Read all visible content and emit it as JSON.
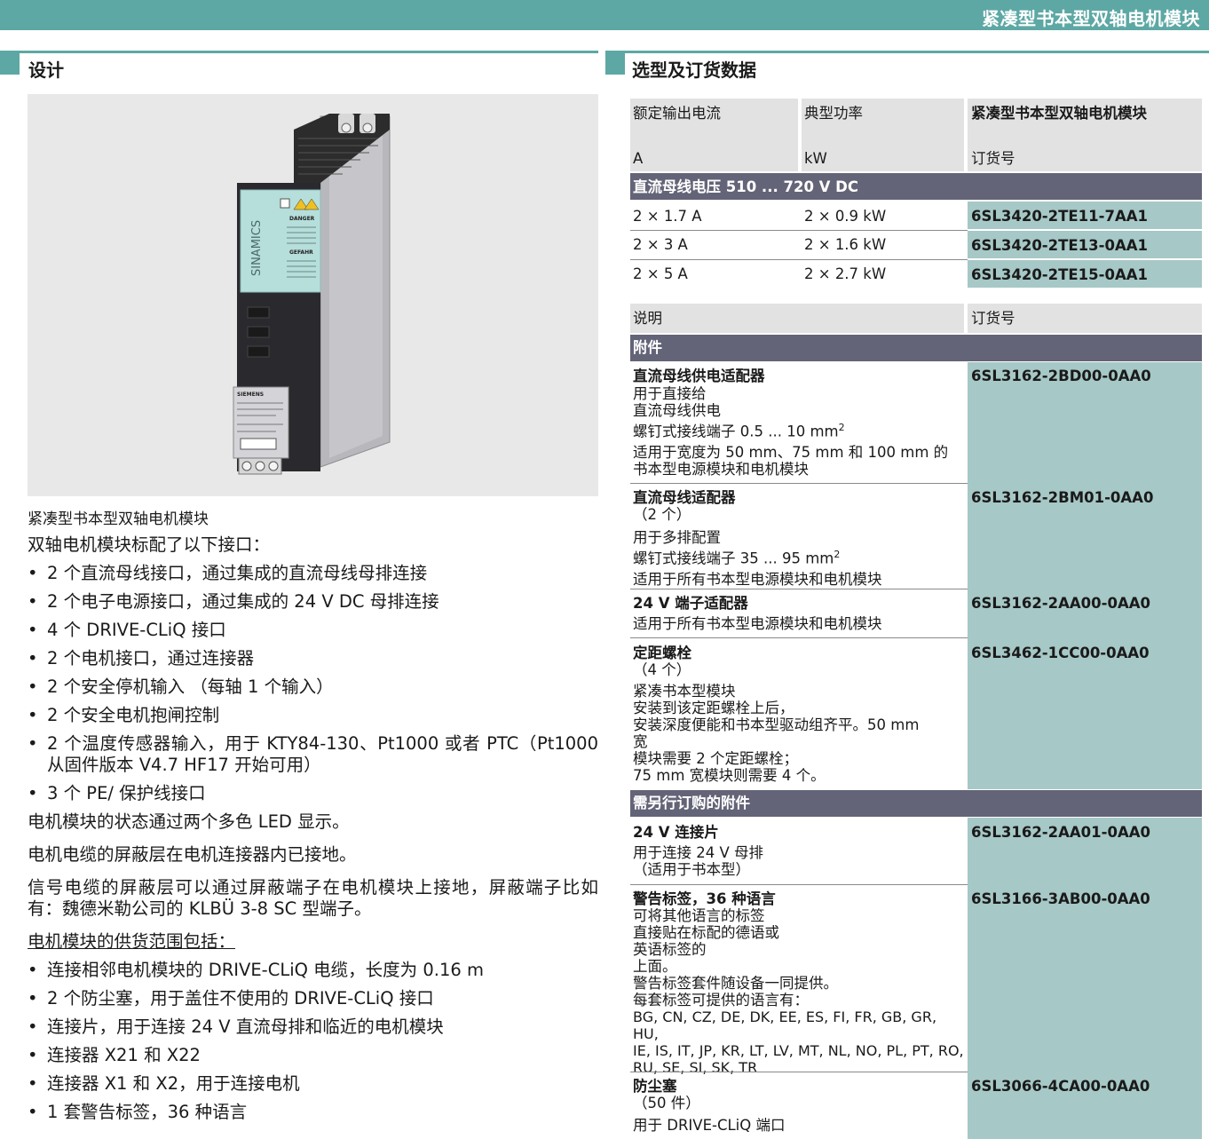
{
  "header": {
    "title": "紧凑型书本型双轴电机模块"
  },
  "left": {
    "section_title": "设计",
    "image_caption": "紧凑型书本型双轴电机模块",
    "intro": "双轴电机模块标配了以下接口：",
    "interfaces": [
      "2 个直流母线接口，通过集成的直流母线母排连接",
      "2 个电子电源接口，通过集成的 24 V DC 母排连接",
      "4 个 DRIVE-CLiQ 接口",
      "2 个电机接口，通过连接器",
      "2 个安全停机输入 （每轴 1 个输入）",
      "2 个安全电机抱闸控制",
      "2 个温度传感器输入，用于 KTY84-130、Pt1000 或者 PTC（Pt1000 从固件版本 V4.7 HF17 开始可用）",
      "3 个 PE/ 保护线接口"
    ],
    "para1": "电机模块的状态通过两个多色 LED 显示。",
    "para2": "电机电缆的屏蔽层在电机连接器内已接地。",
    "para3": "信号电缆的屏蔽层可以通过屏蔽端子在电机模块上接地，屏蔽端子比如有：魏德米勒公司的 KLBÜ 3-8 SC 型端子。",
    "scope_title": "电机模块的供货范围包括：",
    "scope": [
      "连接相邻电机模块的 DRIVE-CLiQ 电缆，长度为 0.16 m",
      "2 个防尘塞，用于盖住不使用的 DRIVE-CLiQ 接口",
      "连接片，用于连接 24 V 直流母排和临近的电机模块",
      "连接器 X21 和 X22",
      "连接器 X1 和 X2，用于连接电机",
      "1 套警告标签，36 种语言"
    ],
    "bullet": "•",
    "device": {
      "brand": "SINAMICS",
      "siemens": "SIEMENS",
      "danger": "DANGER",
      "gefahr": "GEFAHR"
    }
  },
  "right": {
    "section_title": "选型及订货数据",
    "t1": {
      "h_current": "额定输出电流",
      "h_current_unit": "A",
      "h_power": "典型功率",
      "h_power_unit": "kW",
      "h_module": "紧凑型书本型双轴电机模块",
      "h_order": "订货号",
      "voltage": "直流母线电压 510 ... 720 V DC",
      "rows": [
        {
          "current": "2 × 1.7 A",
          "power": "2 × 0.9 kW",
          "order": "6SL3420-2TE11-7AA1"
        },
        {
          "current": "2 × 3 A",
          "power": "2 × 1.6 kW",
          "order": "6SL3420-2TE13-0AA1"
        },
        {
          "current": "2 × 5 A",
          "power": "2 × 2.7 kW",
          "order": "6SL3420-2TE15-0AA1"
        }
      ]
    },
    "t2": {
      "h_desc": "说明",
      "h_order": "订货号",
      "acc_title": "附件",
      "acc": [
        {
          "name": "直流母线供电适配器",
          "l1": "用于直接给",
          "l2": "直流母线供电",
          "l3": "螺钉式接线端子 0.5 ... 10 mm",
          "l3_sup": "2",
          "l4": "适用于宽度为 50 mm、75 mm 和 100 mm 的",
          "l5": "书本型电源模块和电机模块",
          "order": "6SL3162-2BD00-0AA0"
        },
        {
          "name": "直流母线适配器",
          "l1": "（2 个）",
          "l2": "用于多排配置",
          "l3": "螺钉式接线端子 35 ... 95 mm",
          "l3_sup": "2",
          "l4": "适用于所有书本型电源模块和电机模块",
          "order": "6SL3162-2BM01-0AA0"
        },
        {
          "name": "24 V 端子适配器",
          "l1": "适用于所有书本型电源模块和电机模块",
          "order": "6SL3162-2AA00-0AA0"
        },
        {
          "name": "定距螺栓",
          "l1": "（4 个）",
          "l2": "紧凑书本型模块",
          "l3": "安装到该定距螺栓上后，",
          "l4": "安装深度便能和书本型驱动组齐平。50 mm",
          "l5": "宽",
          "l6": "模块需要 2 个定距螺栓；",
          "l7": "75 mm 宽模块则需要 4 个。",
          "order": "6SL3462-1CC00-0AA0"
        }
      ],
      "sep_title": "需另行订购的附件",
      "sep": [
        {
          "name": "24 V 连接片",
          "l1": "用于连接 24 V 母排",
          "l2": "（适用于书本型）",
          "order": "6SL3162-2AA01-0AA0"
        },
        {
          "name": "警告标签，36 种语言",
          "l1": "可将其他语言的标签",
          "l2": "直接贴在标配的德语或",
          "l3": "英语标签的",
          "l4": "上面。",
          "l5": "警告标签套件随设备一同提供。",
          "l6": "每套标签可提供的语言有：",
          "l7": "BG, CN, CZ, DE, DK, EE, ES, FI, FR, GB, GR, HU,",
          "l8": "IE, IS, IT, JP, KR, LT, LV, MT, NL, NO, PL, PT, RO,",
          "l9": "RU, SE, SI, SK, TR",
          "order": "6SL3166-3AB00-0AA0"
        },
        {
          "name": "防尘塞",
          "l1": "（50 件）",
          "l2": "用于 DRIVE-CLiQ 端口",
          "order": "6SL3066-4CA00-0AA0"
        }
      ]
    }
  }
}
